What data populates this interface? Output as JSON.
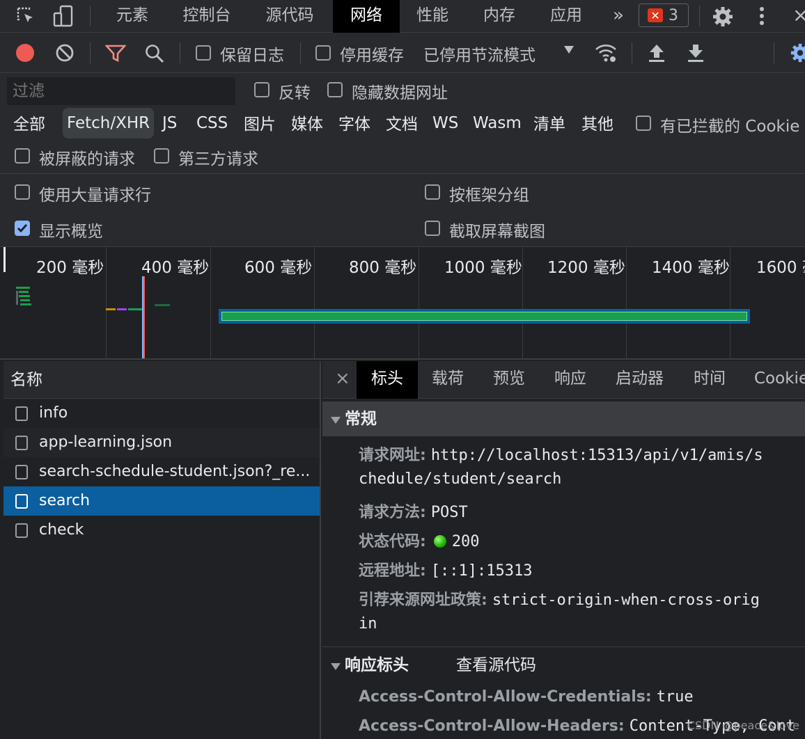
{
  "topbar": {
    "tabs": [
      "元素",
      "控制台",
      "源代码",
      "网络",
      "性能",
      "内存",
      "应用"
    ],
    "active_tab": "网络",
    "more": "»",
    "error_count": "3",
    "close": "×"
  },
  "toolbar": {
    "preserve_log": "保留日志",
    "disable_cache": "停用缓存",
    "throttling": "已停用节流模式"
  },
  "filter": {
    "placeholder": "过滤",
    "invert": "反转",
    "hide_data_urls": "隐藏数据网址",
    "types": [
      "全部",
      "Fetch/XHR",
      "JS",
      "CSS",
      "图片",
      "媒体",
      "字体",
      "文档",
      "WS",
      "Wasm",
      "清单",
      "其他"
    ],
    "active_type": "Fetch/XHR",
    "blocked_cookies": "有已拦截的 Cookie",
    "blocked_requests": "被屏蔽的请求",
    "third_party": "第三方请求"
  },
  "settings": {
    "large_rows": "使用大量请求行",
    "group_by_frame": "按框架分组",
    "show_overview": "显示概览",
    "show_overview_checked": true,
    "capture_screenshots": "截取屏幕截图"
  },
  "overview": {
    "ticks": [
      "200 毫秒",
      "400 毫秒",
      "600 毫秒",
      "800 毫秒",
      "1000 毫秒",
      "1200 毫秒",
      "1400 毫秒",
      "1600 毫秒"
    ]
  },
  "requests": {
    "header": "名称",
    "items": [
      "info",
      "app-learning.json",
      "search-schedule-student.json?_re...",
      "search",
      "check"
    ],
    "selected": "search"
  },
  "detail": {
    "close": "×",
    "tabs": [
      "标头",
      "载荷",
      "预览",
      "响应",
      "启动器",
      "时间",
      "Cookie"
    ],
    "active_tab": "标头",
    "general": {
      "title": "常规",
      "url_label": "请求网址:",
      "url_line1": "http://localhost:15313/api/v1/amis/s",
      "url_line2": "chedule/student/search",
      "method_label": "请求方法:",
      "method": "POST",
      "status_label": "状态代码:",
      "status": "200",
      "remote_label": "远程地址:",
      "remote": "[::1]:15313",
      "referrer_label": "引荐来源网址政策:",
      "referrer_line1": "strict-origin-when-cross-orig",
      "referrer_line2": "in"
    },
    "response_headers": {
      "title": "响应标头",
      "view_source": "查看源代码",
      "h1_name": "Access-Control-Allow-Credentials:",
      "h1_value": "true",
      "h2_name": "Access-Control-Allow-Headers:",
      "h2_value": "Content-Type, Cont"
    }
  },
  "watermark": "CSDN @peace&love"
}
